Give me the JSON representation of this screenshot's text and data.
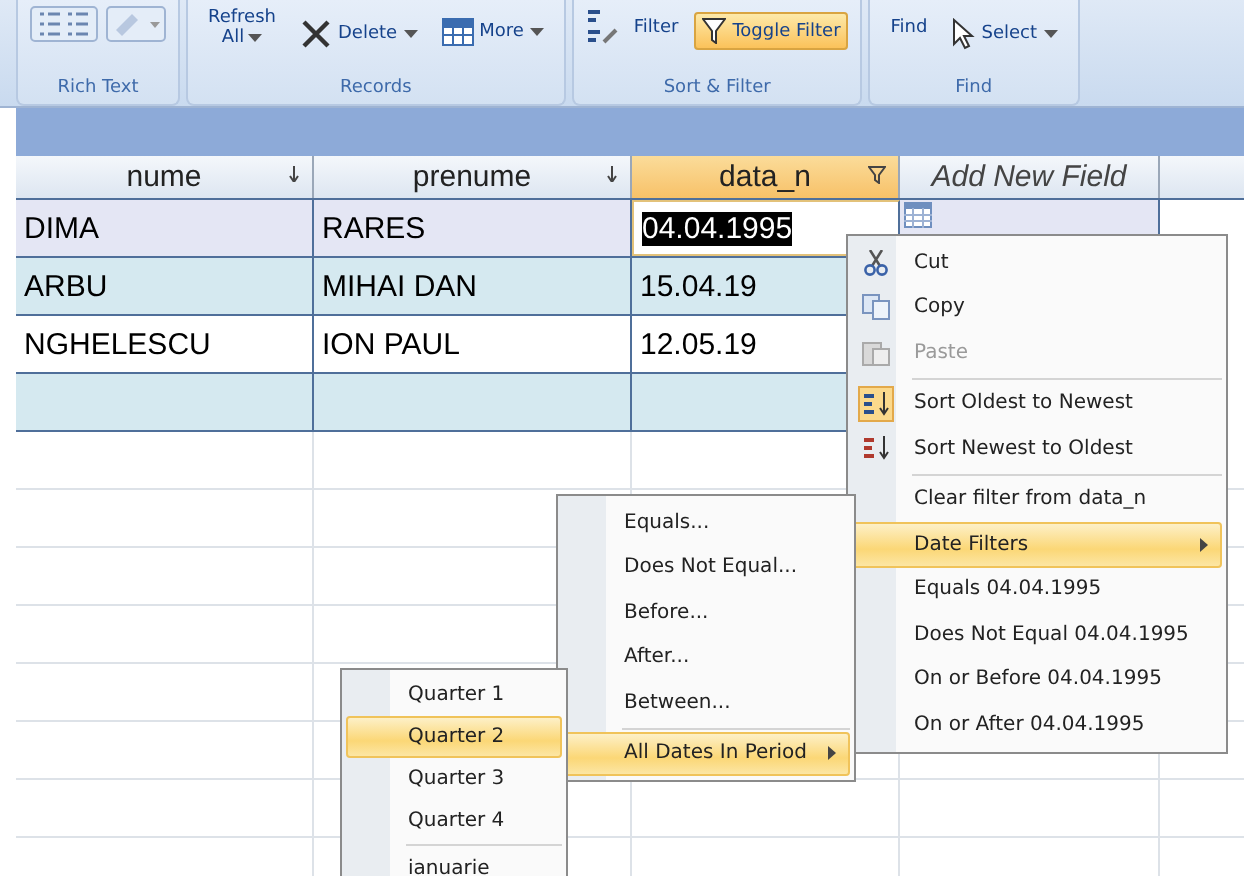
{
  "ribbon": {
    "groups": [
      {
        "label": "Rich Text"
      },
      {
        "label": "Records",
        "controls": [
          {
            "label": "Refresh",
            "label_2": "All",
            "dropdown": true,
            "active": false
          },
          {
            "label": "Delete",
            "dropdown": true,
            "active": false
          },
          {
            "label": "More",
            "dropdown": true,
            "active": false
          }
        ]
      },
      {
        "label": "Sort & Filter",
        "controls": [
          {
            "label": "Filter",
            "dropdown": false,
            "active": false
          },
          {
            "label": "Toggle Filter",
            "dropdown": false,
            "active": true
          }
        ]
      },
      {
        "label": "Find",
        "controls": [
          {
            "label": "Find",
            "dropdown": false,
            "active": false
          },
          {
            "label": "Select",
            "dropdown": true,
            "active": false
          }
        ]
      }
    ]
  },
  "table": {
    "columns": [
      {
        "label": "nume",
        "selected": false,
        "filtered": false
      },
      {
        "label": "prenume",
        "selected": false,
        "filtered": false
      },
      {
        "label": "data_n",
        "selected": true,
        "filtered": true
      },
      {
        "label": "Add New Field",
        "selected": false
      }
    ],
    "rows": [
      {
        "cells": [
          "DIMA",
          "RARES",
          "04.04.1995"
        ],
        "selected": true
      },
      {
        "cells": [
          "ARBU",
          "MIHAI DAN",
          "15.04.19"
        ],
        "selected": false
      },
      {
        "cells": [
          "NGHELESCU",
          "ION PAUL",
          "12.05.19"
        ],
        "selected": false
      }
    ]
  },
  "context_menu": {
    "items": [
      {
        "kind": "item",
        "text": "Cut",
        "selected": false,
        "disabled": false,
        "submenu": false
      },
      {
        "kind": "item",
        "text": "Copy",
        "selected": false,
        "disabled": false,
        "submenu": false
      },
      {
        "kind": "item",
        "text": "Paste",
        "selected": false,
        "disabled": true,
        "submenu": false
      },
      {
        "kind": "separator"
      },
      {
        "kind": "item",
        "text": "Sort Oldest to Newest",
        "selected": false,
        "disabled": false,
        "submenu": false
      },
      {
        "kind": "item",
        "text": "Sort Newest to Oldest",
        "selected": false,
        "disabled": false,
        "submenu": false
      },
      {
        "kind": "separator"
      },
      {
        "kind": "item",
        "text": "Clear filter from data_n",
        "selected": false,
        "disabled": false,
        "submenu": false
      },
      {
        "kind": "item",
        "text": "Date Filters",
        "selected": true,
        "disabled": false,
        "submenu": true
      },
      {
        "kind": "item",
        "text": "Equals 04.04.1995",
        "selected": false,
        "disabled": false,
        "submenu": false
      },
      {
        "kind": "item",
        "text": "Does Not Equal 04.04.1995",
        "selected": false,
        "disabled": false,
        "submenu": false
      },
      {
        "kind": "item",
        "text": "On or Before 04.04.1995",
        "selected": false,
        "disabled": false,
        "submenu": false
      },
      {
        "kind": "item",
        "text": "On or After 04.04.1995",
        "selected": false,
        "disabled": false,
        "submenu": false
      }
    ]
  },
  "date_filters_menu": {
    "items": [
      {
        "kind": "item",
        "text": "Equals...",
        "selected": false,
        "disabled": false,
        "submenu": false
      },
      {
        "kind": "item",
        "text": "Does Not Equal...",
        "selected": false,
        "disabled": false,
        "submenu": false
      },
      {
        "kind": "item",
        "text": "Before...",
        "selected": false,
        "disabled": false,
        "submenu": false
      },
      {
        "kind": "item",
        "text": "After...",
        "selected": false,
        "disabled": false,
        "submenu": false
      },
      {
        "kind": "item",
        "text": "Between...",
        "selected": false,
        "disabled": false,
        "submenu": false
      },
      {
        "kind": "separator"
      },
      {
        "kind": "item",
        "text": "All Dates In Period",
        "selected": true,
        "disabled": false,
        "submenu": true
      }
    ]
  },
  "period_menu": {
    "items": [
      {
        "kind": "item",
        "text": "Quarter 1",
        "selected": false,
        "disabled": false,
        "submenu": false
      },
      {
        "kind": "item",
        "text": "Quarter 2",
        "selected": true,
        "disabled": false,
        "submenu": false
      },
      {
        "kind": "item",
        "text": "Quarter 3",
        "selected": false,
        "disabled": false,
        "submenu": false
      },
      {
        "kind": "item",
        "text": "Quarter 4",
        "selected": false,
        "disabled": false,
        "submenu": false
      },
      {
        "kind": "separator"
      },
      {
        "kind": "item",
        "text": "ianuarie",
        "selected": false,
        "disabled": false,
        "submenu": false
      }
    ]
  }
}
